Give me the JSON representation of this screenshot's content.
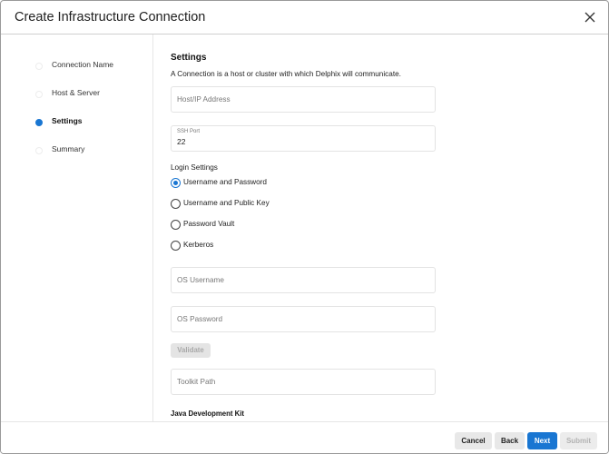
{
  "dialog": {
    "title": "Create Infrastructure Connection",
    "close_icon": "close-icon"
  },
  "steps": [
    {
      "label": "Connection Name",
      "active": false
    },
    {
      "label": "Host & Server",
      "active": false
    },
    {
      "label": "Settings",
      "active": true
    },
    {
      "label": "Summary",
      "active": false
    }
  ],
  "settings": {
    "title": "Settings",
    "description": "A Connection is a host or cluster with which Delphix will communicate.",
    "host_placeholder": "Host/IP Address",
    "ssh_port_label": "SSH Port",
    "ssh_port_value": "22",
    "login_settings_label": "Login Settings",
    "login_options": [
      {
        "label": "Username and Password",
        "selected": true
      },
      {
        "label": "Username and Public Key",
        "selected": false
      },
      {
        "label": "Password Vault",
        "selected": false
      },
      {
        "label": "Kerberos",
        "selected": false
      }
    ],
    "os_username_placeholder": "OS Username",
    "os_password_placeholder": "OS Password",
    "validate_label": "Validate",
    "toolkit_path_placeholder": "Toolkit Path",
    "jdk_title": "Java Development Kit"
  },
  "footer": {
    "cancel_label": "Cancel",
    "back_label": "Back",
    "next_label": "Next",
    "submit_label": "Submit"
  },
  "colors": {
    "accent": "#1976d2",
    "disabled": "#e4e4e4"
  }
}
